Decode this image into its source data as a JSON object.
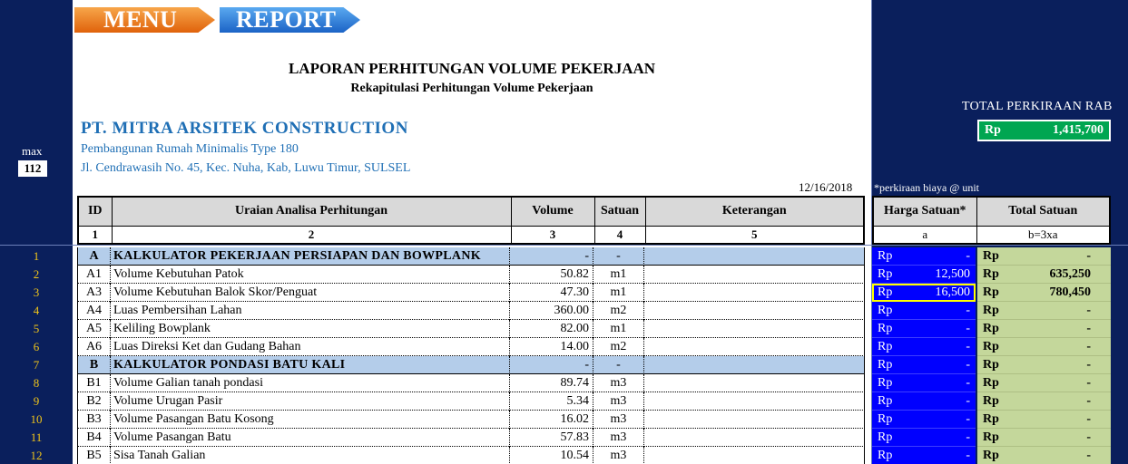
{
  "nav": {
    "menu_label": "MENU",
    "report_label": "REPORT"
  },
  "report": {
    "title": "LAPORAN PERHITUNGAN VOLUME PEKERJAAN",
    "subtitle": "Rekapitulasi Perhitungan Volume Pekerjaan",
    "company": "PT. MITRA ARSITEK CONSTRUCTION",
    "project": "Pembangunan Rumah Minimalis Type 180",
    "address": "Jl. Cendrawasih No. 45, Kec. Nuha, Kab, Luwu Timur, SULSEL",
    "date": "12/16/2018"
  },
  "max": {
    "label": "max",
    "value": "112"
  },
  "rab": {
    "label": "TOTAL PERKIRAAN  RAB",
    "currency": "Rp",
    "value": "1,415,700"
  },
  "note": "*perkiraan biaya @ unit",
  "headers": {
    "id": "ID",
    "uraian": "Uraian Analisa Perhitungan",
    "volume": "Volume",
    "satuan": "Satuan",
    "keterangan": "Keterangan",
    "n1": "1",
    "n2": "2",
    "n3": "3",
    "n4": "4",
    "n5": "5",
    "harga": "Harga Satuan*",
    "total": "Total Satuan",
    "harga_sub": "a",
    "total_sub": "b=3xa"
  },
  "rows": [
    {
      "num": "1",
      "id": "A",
      "desc": "KALKULATOR PEKERJAAN PERSIAPAN DAN BOWPLANK",
      "vol": "-",
      "sat": "-",
      "ket": "",
      "section": true,
      "h_rp": "Rp",
      "h_val": "-",
      "t_rp": "Rp",
      "t_val": "-"
    },
    {
      "num": "2",
      "id": "A1",
      "desc": "Volume Kebutuhan Patok",
      "vol": "50.82",
      "sat": "m1",
      "ket": "",
      "section": false,
      "h_rp": "Rp",
      "h_val": "12,500",
      "t_rp": "Rp",
      "t_val": "635,250"
    },
    {
      "num": "3",
      "id": "A3",
      "desc": "Volume Kebutuhan Balok Skor/Penguat",
      "vol": "47.30",
      "sat": "m1",
      "ket": "",
      "section": false,
      "h_rp": "Rp",
      "h_val": "16,500",
      "t_rp": "Rp",
      "t_val": "780,450",
      "selected": true
    },
    {
      "num": "4",
      "id": "A4",
      "desc": "Luas Pembersihan Lahan",
      "vol": "360.00",
      "sat": "m2",
      "ket": "",
      "section": false,
      "h_rp": "Rp",
      "h_val": "-",
      "t_rp": "Rp",
      "t_val": "-"
    },
    {
      "num": "5",
      "id": "A5",
      "desc": "Keliling Bowplank",
      "vol": "82.00",
      "sat": "m1",
      "ket": "",
      "section": false,
      "h_rp": "Rp",
      "h_val": "-",
      "t_rp": "Rp",
      "t_val": "-"
    },
    {
      "num": "6",
      "id": "A6",
      "desc": "Luas Direksi Ket dan Gudang Bahan",
      "vol": "14.00",
      "sat": "m2",
      "ket": "",
      "section": false,
      "h_rp": "Rp",
      "h_val": "-",
      "t_rp": "Rp",
      "t_val": "-"
    },
    {
      "num": "7",
      "id": "B",
      "desc": "KALKULATOR PONDASI BATU KALI",
      "vol": "-",
      "sat": "-",
      "ket": "",
      "section": true,
      "h_rp": "Rp",
      "h_val": "-",
      "t_rp": "Rp",
      "t_val": "-"
    },
    {
      "num": "8",
      "id": "B1",
      "desc": "Volume Galian tanah pondasi",
      "vol": "89.74",
      "sat": "m3",
      "ket": "",
      "section": false,
      "h_rp": "Rp",
      "h_val": "-",
      "t_rp": "Rp",
      "t_val": "-"
    },
    {
      "num": "9",
      "id": "B2",
      "desc": "Volume Urugan Pasir",
      "vol": "5.34",
      "sat": "m3",
      "ket": "",
      "section": false,
      "h_rp": "Rp",
      "h_val": "-",
      "t_rp": "Rp",
      "t_val": "-"
    },
    {
      "num": "10",
      "id": "B3",
      "desc": "Volume Pasangan Batu Kosong",
      "vol": "16.02",
      "sat": "m3",
      "ket": "",
      "section": false,
      "h_rp": "Rp",
      "h_val": "-",
      "t_rp": "Rp",
      "t_val": "-"
    },
    {
      "num": "11",
      "id": "B4",
      "desc": "Volume Pasangan Batu",
      "vol": "57.83",
      "sat": "m3",
      "ket": "",
      "section": false,
      "h_rp": "Rp",
      "h_val": "-",
      "t_rp": "Rp",
      "t_val": "-"
    },
    {
      "num": "12",
      "id": "B5",
      "desc": "Sisa Tanah Galian",
      "vol": "10.54",
      "sat": "m3",
      "ket": "",
      "section": false,
      "h_rp": "Rp",
      "h_val": "-",
      "t_rp": "Rp",
      "t_val": "-"
    }
  ],
  "colors": {
    "background": "#0a1f5c",
    "harga_cell": "#0000ff",
    "total_cell": "#c4d79b",
    "section_row": "#b4cdea",
    "rab_box": "#00a651",
    "menu_btn": "#e0620b",
    "report_btn": "#1b63c6"
  }
}
